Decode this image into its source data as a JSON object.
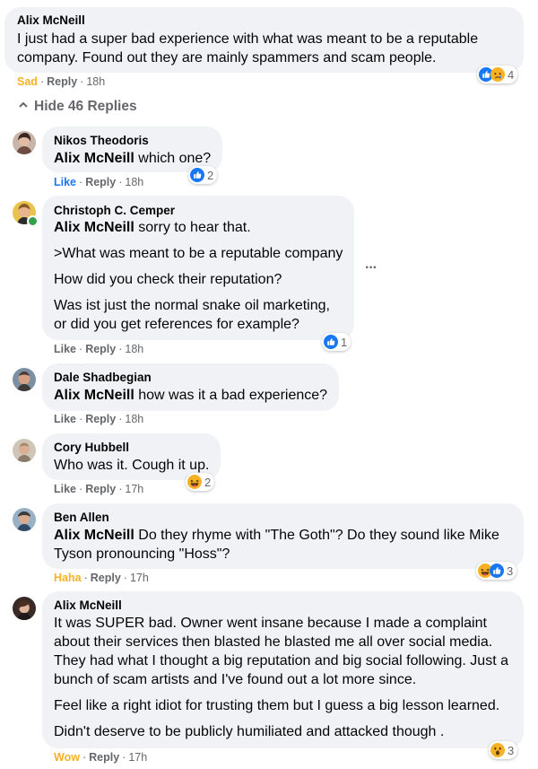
{
  "colors": {
    "sad": "#f7b125",
    "like": "#1877f2",
    "haha": "#f7b125",
    "wow": "#f7b125",
    "meta": "#65676b",
    "bubble": "#f0f2f5"
  },
  "top_comment": {
    "author": "Alix McNeill",
    "lines": [
      "I just had a super bad experience with what was meant to be a reputable",
      "company. Found out they are mainly spammers and scam people."
    ],
    "my_reaction": "Sad",
    "reply": "Reply",
    "time": "18h",
    "reaction_count": "4",
    "reaction_icons": [
      "like-icon",
      "sad-icon"
    ]
  },
  "hide_replies": "Hide 46 Replies",
  "replies": [
    {
      "author": "Nikos Theodoris",
      "mention": "Alix McNeill",
      "text": " which one?",
      "action": "Like",
      "reply": "Reply",
      "time": "18h",
      "reaction_count": "2",
      "reaction_icons": [
        "like-icon"
      ]
    },
    {
      "author": "Christoph C. Cemper",
      "mention": "Alix McNeill",
      "text": " sorry to hear that.",
      "paragraphs": [
        ">What was meant to be a reputable company",
        "How did you check their reputation?",
        "Was ist just the normal snake oil marketing,",
        "or did you get references for example?"
      ],
      "action": "Like",
      "reply": "Reply",
      "time": "18h",
      "reaction_count": "1",
      "reaction_icons": [
        "like-icon"
      ],
      "more": "···"
    },
    {
      "author": "Dale Shadbegian",
      "mention": "Alix McNeill",
      "text": " how was it a bad experience?",
      "action": "Like",
      "reply": "Reply",
      "time": "18h"
    },
    {
      "author": "Cory Hubbell",
      "text": "Who was it. Cough it up.",
      "action": "Like",
      "reply": "Reply",
      "time": "17h",
      "reaction_count": "2",
      "reaction_icons": [
        "haha-icon"
      ]
    },
    {
      "author": "Ben Allen",
      "mention": "Alix McNeill",
      "text": " Do they rhyme with \"The Goth\"? Do they sound like Mike",
      "line2": "Tyson pronouncing \"Hoss\"?",
      "action": "Haha",
      "reply": "Reply",
      "time": "17h",
      "reaction_count": "3",
      "reaction_icons": [
        "haha-icon",
        "like-icon"
      ]
    },
    {
      "author": "Alix McNeill",
      "paragraphs": [
        "It was SUPER bad. Owner went insane because I made a complaint",
        "about their services then blasted he blasted me all over social media.",
        "They had what I thought a big reputation and big social following. Just a",
        "bunch of scam artists and I've found out a lot more since.",
        "Feel like a right idiot for trusting them but I guess a big lesson learned.",
        "Didn't deserve to be publicly humiliated and attacked though ."
      ],
      "action": "Wow",
      "reply": "Reply",
      "time": "17h",
      "reaction_count": "3",
      "reaction_icons": [
        "wow-icon"
      ]
    }
  ]
}
